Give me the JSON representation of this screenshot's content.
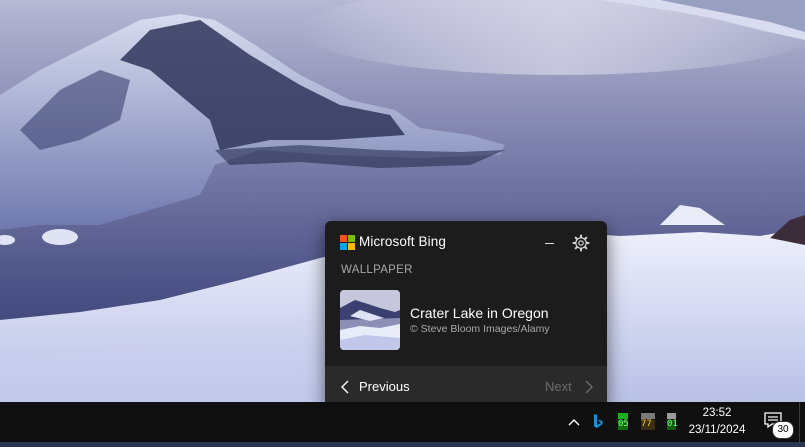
{
  "flyout": {
    "brand": "Microsoft Bing",
    "section_title": "WALLPAPER",
    "wallpaper_title": "Crater Lake in Oregon",
    "wallpaper_credit": "© Steve Bloom Images/Alamy",
    "previous_label": "Previous",
    "next_label": "Next",
    "logo_colors": [
      "#f25022",
      "#7fba00",
      "#00a4ef",
      "#ffb900"
    ]
  },
  "taskbar": {
    "time": "23:52",
    "date": "23/11/2024",
    "notification_count": "30",
    "tray_icons": [
      "chevron-up-icon",
      "bing-icon",
      "cpu-temp-icon",
      "gpu-temp-icon",
      "drive-temp-icon"
    ],
    "tray_values": [
      "05",
      "77",
      "01"
    ]
  }
}
